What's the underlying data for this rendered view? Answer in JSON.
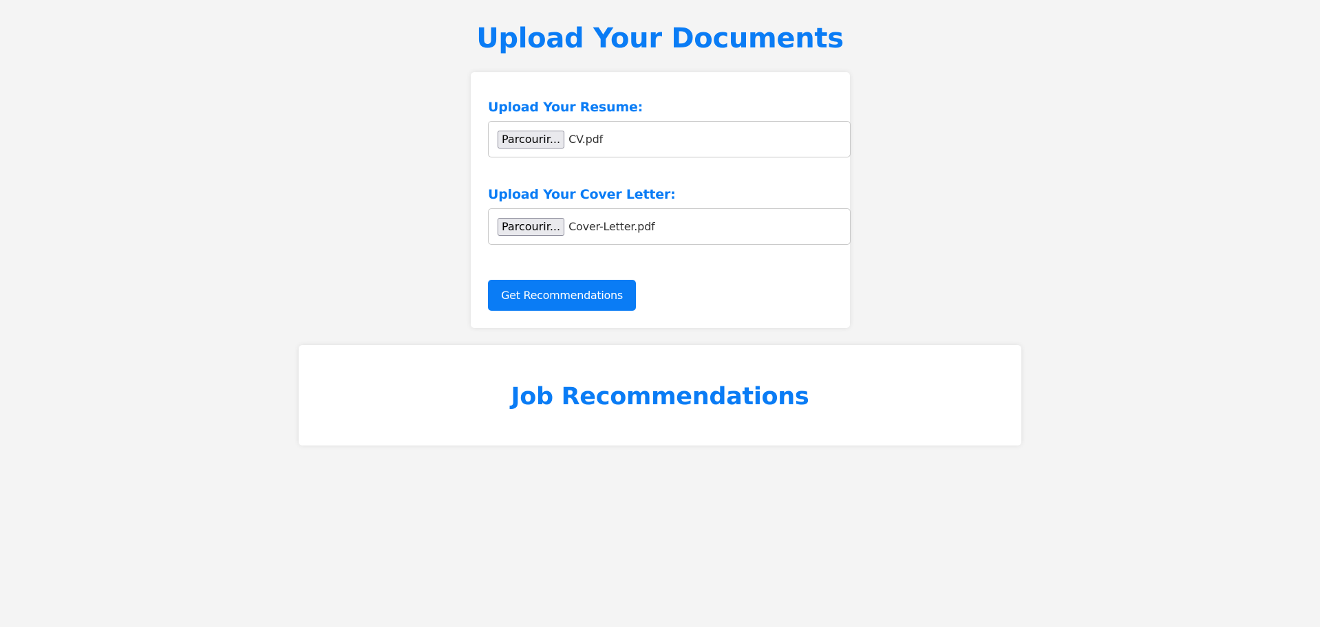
{
  "page": {
    "title": "Upload Your Documents"
  },
  "upload_form": {
    "resume": {
      "label": "Upload Your Resume:",
      "browse_label": "Parcourir...",
      "file_name": "CV.pdf"
    },
    "cover_letter": {
      "label": "Upload Your Cover Letter:",
      "browse_label": "Parcourir...",
      "file_name": "Cover-Letter.pdf"
    },
    "submit_label": "Get Recommendations"
  },
  "results": {
    "title": "Job Recommendations"
  },
  "colors": {
    "accent": "#0a7cf5",
    "background": "#f4f4f4",
    "card": "#ffffff"
  }
}
